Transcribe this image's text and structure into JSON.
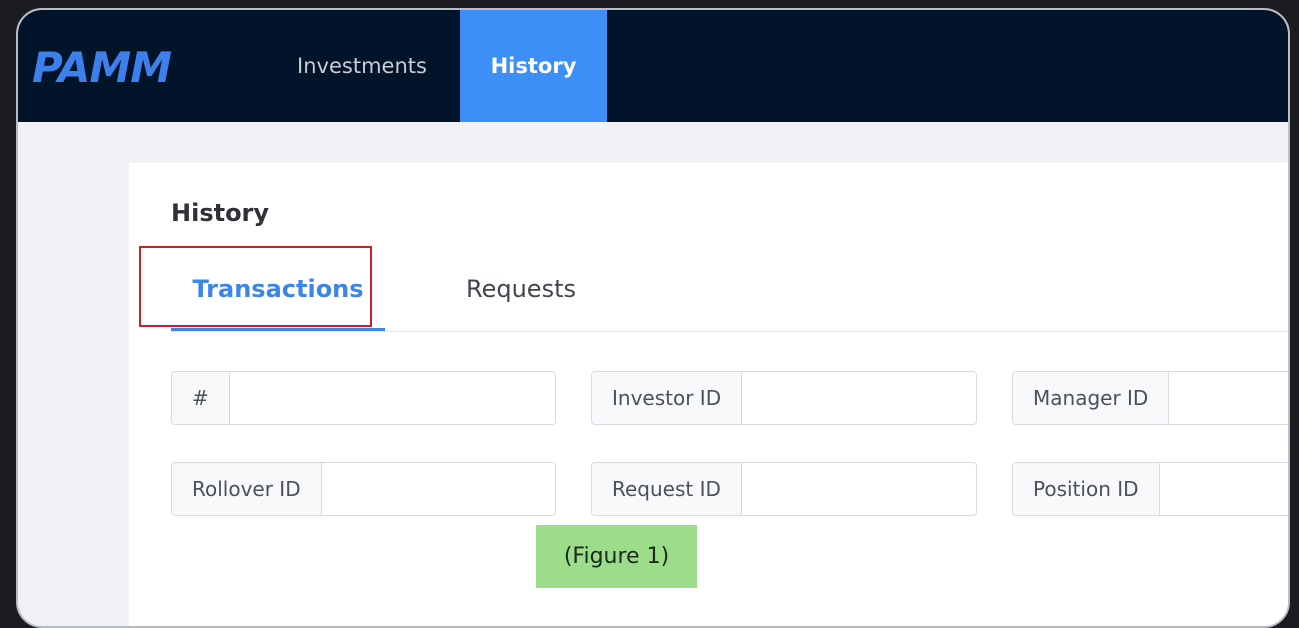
{
  "app": {
    "logo_text": "PAMM"
  },
  "nav": {
    "tabs": [
      {
        "label": "Investments",
        "active": false
      },
      {
        "label": "History",
        "active": true
      }
    ]
  },
  "panel": {
    "title": "History",
    "tabs": [
      {
        "label": "Transactions",
        "active": true
      },
      {
        "label": "Requests",
        "active": false
      }
    ]
  },
  "filters": [
    {
      "label": "#",
      "value": ""
    },
    {
      "label": "Investor ID",
      "value": ""
    },
    {
      "label": "Manager ID",
      "value": ""
    },
    {
      "label": "Rollover ID",
      "value": ""
    },
    {
      "label": "Request ID",
      "value": ""
    },
    {
      "label": "Position ID",
      "value": ""
    }
  ],
  "annotation": {
    "caption": "(Figure 1)",
    "highlight_color": "#d11f25"
  },
  "colors": {
    "topbar": "#021429",
    "accent": "#3e8ef7",
    "caption_bg": "#9bdd8b"
  }
}
